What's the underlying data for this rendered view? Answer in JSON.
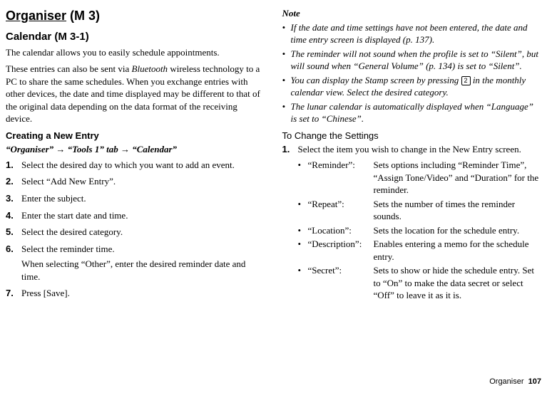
{
  "left": {
    "title_main": "Organiser",
    "title_code": " (M 3)",
    "subtitle_main": "Calendar",
    "subtitle_code": " (M 3-1)",
    "intro1": "The calendar allows you to easily schedule appointments.",
    "intro2_a": "These entries can also be sent via ",
    "intro2_b": "Bluetooth",
    "intro2_c": " wireless technology to a PC to share the same schedules. When you exchange entries with other devices, the date and time displayed may be different to that of the original data depending on the data format of the receiving device.",
    "section_create": "Creating a New Entry",
    "path": "“Organiser” → “Tools 1” tab → “Calendar”",
    "steps": [
      "Select the desired day to which you want to add an event.",
      "Select “Add New Entry”.",
      "Enter the subject.",
      "Enter the start date and time.",
      "Select the desired category.",
      "Select the reminder time.",
      "Press [Save]."
    ],
    "step6_sub": "When selecting “Other”, enter the desired reminder date and time."
  },
  "right": {
    "note_head": "Note",
    "notes": [
      "If the date and time settings have not been entered, the date and time entry screen is displayed (p. 137).",
      "The reminder will not sound when the profile is set to “Silent”, but will sound when “General Volume” (p. 134) is set to “Silent”.",
      "",
      "The lunar calendar is automatically displayed when “Language” is set to “Chinese”."
    ],
    "note3_a": "You can display the Stamp screen by pressing ",
    "note3_key": "2",
    "note3_b": " in the monthly calendar view. Select the desired category.",
    "settings_head": "To Change the Settings",
    "step1_num": "1.",
    "step1_text": "Select the item you wish to change in the New Entry screen.",
    "options": [
      {
        "label": "“Reminder”:",
        "desc": "Sets options including “Reminder Time”, “Assign Tone/Video” and “Duration” for the reminder."
      },
      {
        "label": "“Repeat”:",
        "desc": "Sets the number of times the reminder sounds."
      },
      {
        "label": "“Location”:",
        "desc": "Sets the location for the schedule entry."
      },
      {
        "label": "“Description”:",
        "desc": "Enables entering a memo for the schedule entry."
      },
      {
        "label": "“Secret”:",
        "desc": "Sets to show or hide the schedule entry. Set to “On” to make the data secret or select “Off” to leave it as it is."
      }
    ]
  },
  "footer": {
    "label": "Organiser",
    "page": "107"
  }
}
